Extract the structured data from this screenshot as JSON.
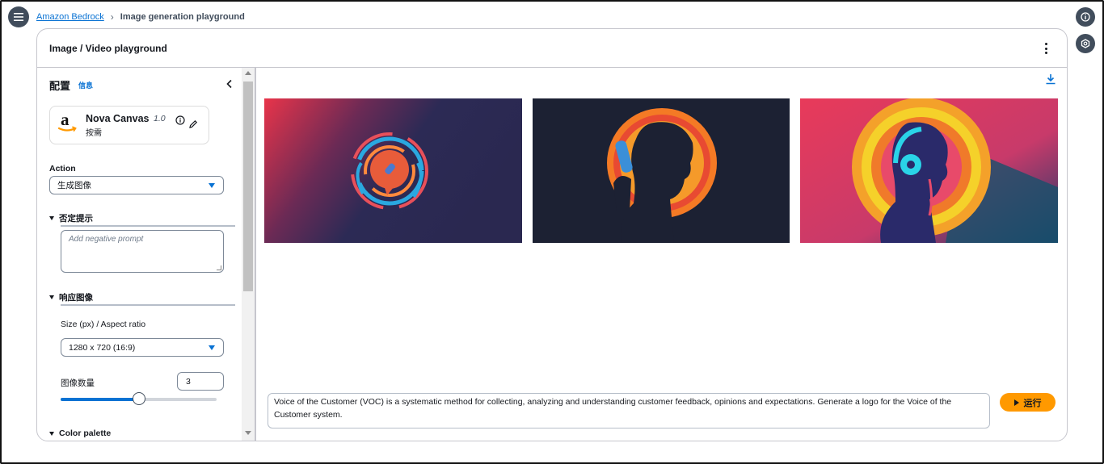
{
  "breadcrumb": {
    "root": "Amazon Bedrock",
    "current": "Image generation playground"
  },
  "container": {
    "title": "Image / Video playground"
  },
  "config": {
    "title": "配置",
    "info_link": "信息",
    "model": {
      "name": "Nova Canvas",
      "version": "1.0",
      "pricing": "按需"
    },
    "action": {
      "label": "Action",
      "value": "生成图像"
    },
    "negative_prompt": {
      "section_label": "否定提示",
      "placeholder": "Add negative prompt"
    },
    "response_image": {
      "section_label": "响应图像",
      "size_label": "Size (px) / Aspect ratio",
      "size_value": "1280 x 720 (16:9)",
      "count_label": "图像数量",
      "count_value": "3",
      "count_slider_fraction": 0.5
    },
    "color_palette": {
      "section_label": "Color palette"
    }
  },
  "images": [
    {
      "name": "voc-logo-microphone-bubble"
    },
    {
      "name": "voc-logo-speaker-silhouette"
    },
    {
      "name": "voc-logo-headphones-profile"
    }
  ],
  "prompt": {
    "text": "Voice of the Customer (VOC) is a systematic method for collecting, analyzing and understanding customer feedback, opinions and expectations. Generate a logo for the Voice of the Customer system."
  },
  "run_button": {
    "label": "运行"
  },
  "colors": {
    "accent": "#0972d3",
    "run": "#ff9900",
    "dark": "#414d5c"
  },
  "icons": [
    "menu-icon",
    "chevron-right-icon",
    "info-icon",
    "settings-icon",
    "kebab-icon",
    "chevron-left-icon",
    "amazon-logo",
    "edit-icon",
    "caret-down-icon",
    "download-icon",
    "play-icon"
  ]
}
